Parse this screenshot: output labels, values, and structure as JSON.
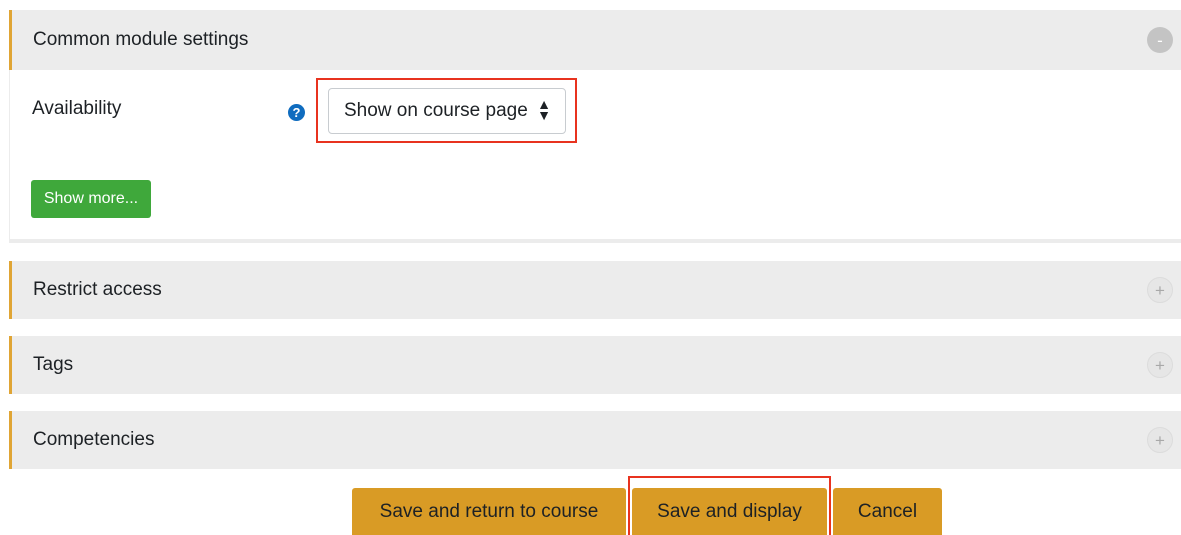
{
  "sections": {
    "common": {
      "title": "Common module settings",
      "toggle": "-",
      "icon": "collapse-icon"
    },
    "restrict": {
      "title": "Restrict access",
      "toggle": "+",
      "icon": "expand-icon"
    },
    "tags": {
      "title": "Tags",
      "toggle": "+",
      "icon": "expand-icon"
    },
    "competencies": {
      "title": "Competencies",
      "toggle": "+",
      "icon": "expand-icon"
    }
  },
  "availability": {
    "label": "Availability",
    "help_glyph": "?",
    "selected_value": "Show on course page",
    "arrows": "⇕"
  },
  "show_more_label": "Show more...",
  "actions": {
    "save_return": "Save and return to course",
    "save_display": "Save and display",
    "cancel": "Cancel"
  },
  "colors": {
    "accent": "#e0a535",
    "action_button": "#d99b25",
    "green_button": "#3fa83b",
    "highlight": "#e8331f",
    "help_icon": "#0f6cbf"
  }
}
